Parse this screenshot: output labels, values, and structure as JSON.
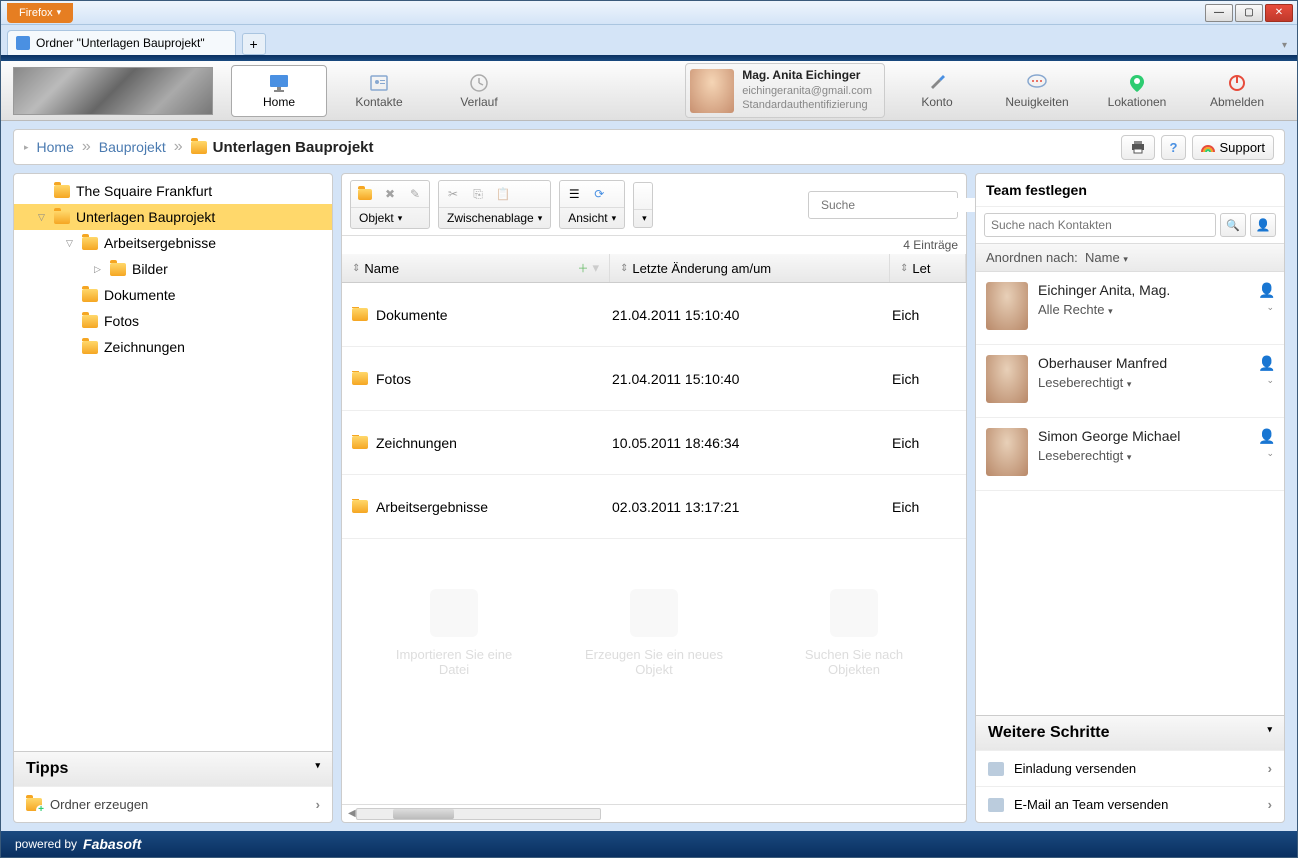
{
  "window": {
    "firefox_label": "Firefox",
    "tab_title": "Ordner \"Unterlagen Bauprojekt\""
  },
  "header": {
    "nav": {
      "home": "Home",
      "kontakte": "Kontakte",
      "verlauf": "Verlauf",
      "konto": "Konto",
      "neuigkeiten": "Neuigkeiten",
      "lokationen": "Lokationen",
      "abmelden": "Abmelden"
    },
    "user": {
      "name": "Mag. Anita Eichinger",
      "email": "eichingeranita@gmail.com",
      "auth": "Standardauthentifizierung"
    }
  },
  "breadcrumb": {
    "home": "Home",
    "bauprojekt": "Bauprojekt",
    "current": "Unterlagen Bauprojekt",
    "support": "Support"
  },
  "tree": {
    "items": [
      {
        "label": "The Squaire Frankfurt",
        "depth": 1,
        "expand": ""
      },
      {
        "label": "Unterlagen Bauprojekt",
        "depth": 1,
        "expand": "▽",
        "selected": true
      },
      {
        "label": "Arbeitsergebnisse",
        "depth": 2,
        "expand": "▽"
      },
      {
        "label": "Bilder",
        "depth": 3,
        "expand": "▷"
      },
      {
        "label": "Dokumente",
        "depth": 2,
        "expand": ""
      },
      {
        "label": "Fotos",
        "depth": 2,
        "expand": ""
      },
      {
        "label": "Zeichnungen",
        "depth": 2,
        "expand": ""
      }
    ]
  },
  "tipps": {
    "header": "Tipps",
    "create_folder": "Ordner erzeugen"
  },
  "toolbar": {
    "objekt": "Objekt",
    "zwischenablage": "Zwischenablage",
    "ansicht": "Ansicht",
    "search_placeholder": "Suche"
  },
  "table": {
    "count_label": "4 Einträge",
    "col_name": "Name",
    "col_modified": "Letzte Änderung am/um",
    "col_user_short": "Let",
    "rows": [
      {
        "name": "Dokumente",
        "modified": "21.04.2011 15:10:40",
        "user": "Eich"
      },
      {
        "name": "Fotos",
        "modified": "21.04.2011 15:10:40",
        "user": "Eich"
      },
      {
        "name": "Zeichnungen",
        "modified": "10.05.2011 18:46:34",
        "user": "Eich"
      },
      {
        "name": "Arbeitsergebnisse",
        "modified": "02.03.2011 13:17:21",
        "user": "Eich"
      }
    ]
  },
  "ghosts": {
    "import": "Importieren Sie eine Datei",
    "create": "Erzeugen Sie ein neues Objekt",
    "search": "Suchen Sie nach Objekten"
  },
  "team": {
    "header": "Team festlegen",
    "search_placeholder": "Suche nach Kontakten",
    "sort_label": "Anordnen nach:",
    "sort_field": "Name",
    "members": [
      {
        "name": "Eichinger Anita, Mag.",
        "role": "Alle Rechte"
      },
      {
        "name": "Oberhauser Manfred",
        "role": "Leseberechtigt"
      },
      {
        "name": "Simon George Michael",
        "role": "Leseberechtigt"
      }
    ]
  },
  "weitere": {
    "header": "Weitere Schritte",
    "steps": [
      "Einladung versenden",
      "E-Mail an Team versenden"
    ]
  },
  "footer": {
    "powered": "powered by",
    "brand": "Fabasoft"
  }
}
